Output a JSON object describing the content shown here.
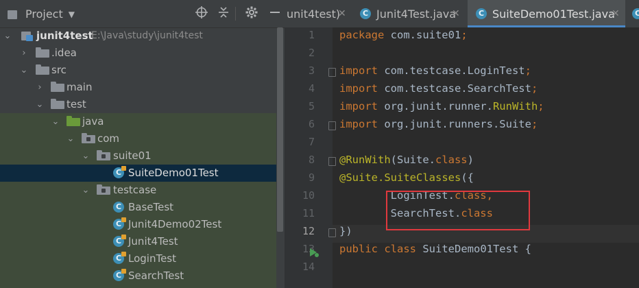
{
  "project_panel": {
    "title": "Project",
    "dropdown_icon": "chevron-down-icon",
    "toolbar_icons": [
      "locate-icon",
      "collapse-all-icon",
      "gear-icon",
      "hide-icon"
    ],
    "tree": [
      {
        "label": "junit4test",
        "sublabel": "E:\\Java\\study\\junit4test",
        "type": "project",
        "expanded": true
      },
      {
        "label": ".idea",
        "type": "folder",
        "expanded": false
      },
      {
        "label": "src",
        "type": "folder",
        "expanded": true
      },
      {
        "label": "main",
        "type": "folder",
        "expanded": false
      },
      {
        "label": "test",
        "type": "folder",
        "expanded": true
      },
      {
        "label": "java",
        "type": "test-source-folder",
        "expanded": true
      },
      {
        "label": "com",
        "type": "package",
        "expanded": true
      },
      {
        "label": "suite01",
        "type": "package",
        "expanded": true
      },
      {
        "label": "SuiteDemo01Test",
        "type": "class",
        "selected": true
      },
      {
        "label": "testcase",
        "type": "package",
        "expanded": true
      },
      {
        "label": "BaseTest",
        "type": "class"
      },
      {
        "label": "Junit4Demo02Test",
        "type": "class"
      },
      {
        "label": "Junit4Test",
        "type": "class"
      },
      {
        "label": "LoginTest",
        "type": "class"
      },
      {
        "label": "SearchTest",
        "type": "class"
      }
    ]
  },
  "tabs": [
    {
      "label": "unit4test)",
      "active": false,
      "close": "✕"
    },
    {
      "label": "Junit4Test.java",
      "active": false,
      "close": "✕"
    },
    {
      "label": "SuiteDemo01Test.java",
      "active": true,
      "close": "✕"
    }
  ],
  "editor": {
    "current_line": 12,
    "line_numbers": [
      "1",
      "2",
      "3",
      "4",
      "5",
      "6",
      "7",
      "8",
      "9",
      "10",
      "11",
      "12",
      "13",
      "14"
    ],
    "lines": [
      [
        {
          "t": "package ",
          "c": "kw"
        },
        {
          "t": "com.suite01",
          "c": ""
        },
        {
          "t": ";",
          "c": "kw"
        }
      ],
      [],
      [
        {
          "t": "import ",
          "c": "kw"
        },
        {
          "t": "com.testcase.LoginTest",
          "c": ""
        },
        {
          "t": ";",
          "c": "kw"
        }
      ],
      [
        {
          "t": "import ",
          "c": "kw"
        },
        {
          "t": "com.testcase.SearchTest",
          "c": ""
        },
        {
          "t": ";",
          "c": "kw"
        }
      ],
      [
        {
          "t": "import ",
          "c": "kw"
        },
        {
          "t": "org.junit.runner.",
          "c": ""
        },
        {
          "t": "RunWith",
          "c": "ann"
        },
        {
          "t": ";",
          "c": "kw"
        }
      ],
      [
        {
          "t": "import ",
          "c": "kw"
        },
        {
          "t": "org.junit.runners.Suite",
          "c": ""
        },
        {
          "t": ";",
          "c": "kw"
        }
      ],
      [],
      [
        {
          "t": "@RunWith",
          "c": "ann"
        },
        {
          "t": "(Suite.",
          "c": ""
        },
        {
          "t": "class",
          "c": "kw"
        },
        {
          "t": ")",
          "c": ""
        }
      ],
      [
        {
          "t": "@Suite.",
          "c": "ann"
        },
        {
          "t": "SuiteClasses",
          "c": "ann"
        },
        {
          "t": "({",
          "c": ""
        }
      ],
      [
        {
          "t": "        LoginTest.",
          "c": ""
        },
        {
          "t": "class,",
          "c": "kw"
        }
      ],
      [
        {
          "t": "        SearchTest.",
          "c": ""
        },
        {
          "t": "class",
          "c": "kw"
        }
      ],
      [
        {
          "t": "})",
          "c": ""
        }
      ],
      [
        {
          "t": "public class ",
          "c": "kw"
        },
        {
          "t": "SuiteDemo01Test {",
          "c": ""
        }
      ],
      []
    ]
  },
  "colors": {
    "panel_bg": "#3c3f41",
    "editor_bg": "#2b2b2b",
    "keyword": "#cc7832",
    "annotation": "#bbb529",
    "highlight_box": "#e0393e",
    "selection_row": "#0d293e",
    "tab_underline": "#4a88c7"
  }
}
